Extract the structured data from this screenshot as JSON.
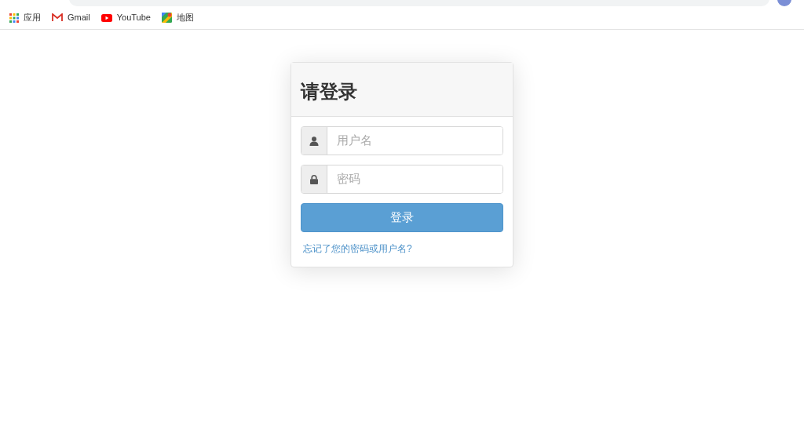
{
  "bookmarks": [
    {
      "kind": "apps",
      "label": "应用"
    },
    {
      "kind": "gmail",
      "label": "Gmail"
    },
    {
      "kind": "youtube",
      "label": "YouTube"
    },
    {
      "kind": "maps",
      "label": "地图"
    }
  ],
  "login": {
    "title": "请登录",
    "fields": [
      {
        "kind": "user",
        "placeholder": "用户名"
      },
      {
        "kind": "password",
        "placeholder": "密码"
      }
    ],
    "submit": "登录",
    "forgot_link": "忘记了您的密码或用户名?"
  }
}
